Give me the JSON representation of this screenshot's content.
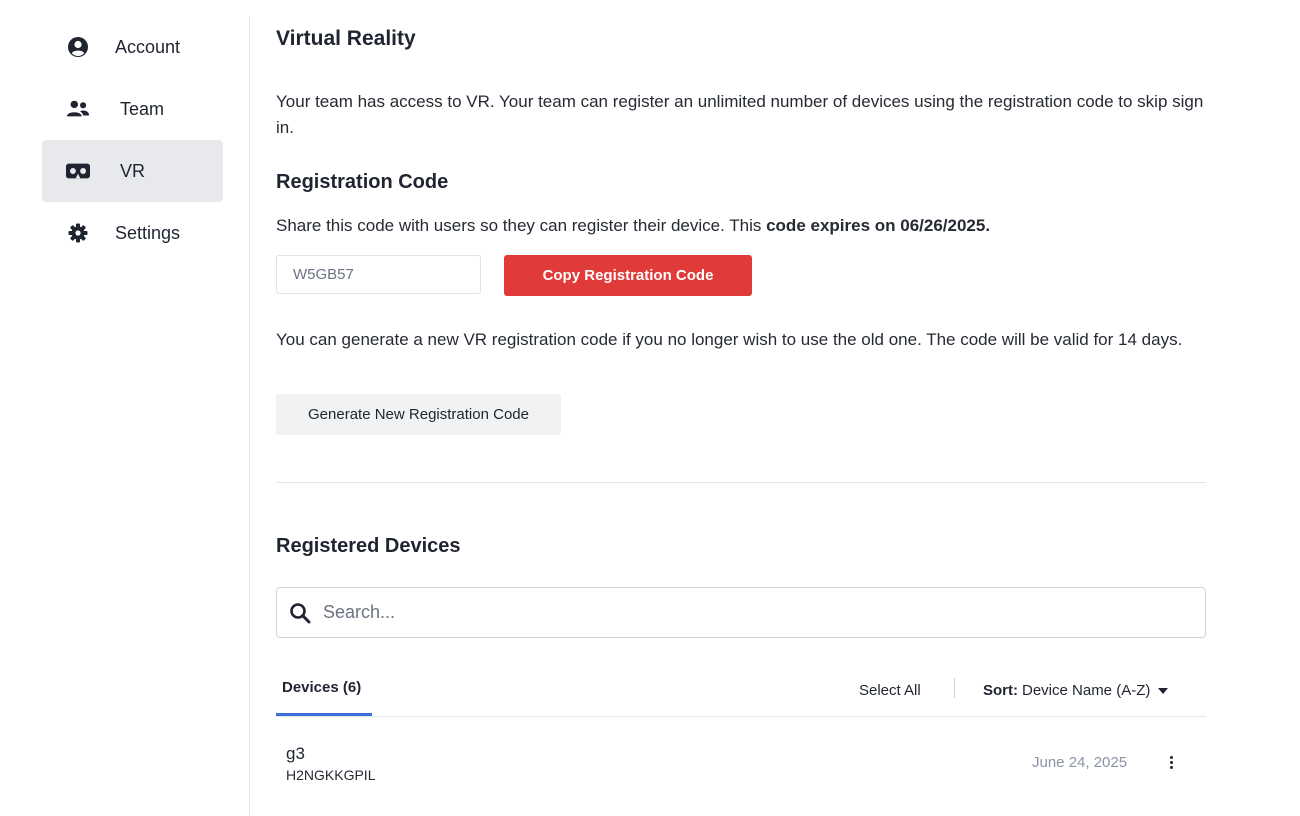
{
  "sidebar": {
    "items": [
      {
        "label": "Account",
        "icon": "user-circle-icon",
        "active": false
      },
      {
        "label": "Team",
        "icon": "users-icon",
        "active": false
      },
      {
        "label": "VR",
        "icon": "vr-headset-icon",
        "active": true
      },
      {
        "label": "Settings",
        "icon": "gear-icon",
        "active": false
      }
    ]
  },
  "main": {
    "title": "Virtual Reality",
    "intro": "Your team has access to VR. Your team can register an unlimited number of devices using the registration code to skip sign in.",
    "registration": {
      "heading": "Registration Code",
      "share_text": "Share this code with users so they can register their device. This ",
      "share_bold": "code expires on 06/26/2025.",
      "code_value": "W5GB57",
      "copy_button": "Copy Registration Code",
      "generate_text": "You can generate a new VR registration code if you no longer wish to use the old one. The code will be valid for 14 days.",
      "generate_button": "Generate New Registration Code"
    },
    "devices": {
      "heading": "Registered Devices",
      "search_placeholder": "Search...",
      "tab_label": "Devices (6)",
      "select_all": "Select All",
      "sort_label": "Sort:",
      "sort_value": "Device Name (A-Z)",
      "rows": [
        {
          "name": "g3",
          "id": "H2NGKKGPIL",
          "date": "June 24, 2025"
        }
      ]
    }
  },
  "colors": {
    "accent_red": "#e03a3a",
    "tab_underline": "#3b6fdb",
    "active_nav_bg": "#e7e9ed"
  }
}
